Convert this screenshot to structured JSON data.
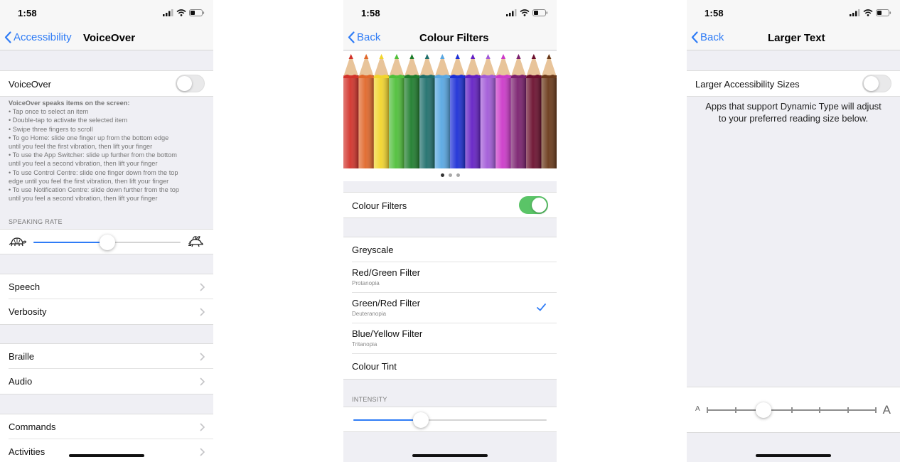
{
  "status": {
    "time": "1:58"
  },
  "phone1": {
    "back_label": "Accessibility",
    "title": "VoiceOver",
    "toggle_label": "VoiceOver",
    "toggle_on": false,
    "description_lines": [
      "VoiceOver speaks items on the screen:",
      "•  Tap once to select an item",
      "•  Double-tap to activate the selected item",
      "•  Swipe three fingers to scroll",
      "•  To go Home: slide one finger up from the bottom edge",
      "until you feel the first vibration, then lift your finger",
      "•  To use the App Switcher: slide up further from the bottom",
      "until you feel a second vibration, then lift your finger",
      "•  To use Control Centre: slide one finger down from the top",
      "edge until you feel the first vibration, then lift your finger",
      "•  To use Notification Centre: slide down further from the top",
      "until you feel a second vibration, then lift your finger"
    ],
    "speaking_rate_header": "SPEAKING RATE",
    "speaking_rate_value": 0.5,
    "groups": [
      [
        "Speech",
        "Verbosity"
      ],
      [
        "Braille",
        "Audio"
      ],
      [
        "Commands",
        "Activities"
      ]
    ]
  },
  "phone2": {
    "back_label": "Back",
    "title": "Colour Filters",
    "pencil_colors": [
      "#d2322a",
      "#e0672a",
      "#f2d52c",
      "#4fbf3a",
      "#1e7d2d",
      "#1f6f6c",
      "#58a7e2",
      "#1c2fd6",
      "#6420c4",
      "#a25ad8",
      "#cc3ac9",
      "#7a1f6e",
      "#6b0f2e",
      "#6b3a1a"
    ],
    "page_dots": 3,
    "active_dot": 0,
    "toggle_label": "Colour Filters",
    "toggle_on": true,
    "filters": [
      {
        "label": "Greyscale",
        "sub": "",
        "checked": false
      },
      {
        "label": "Red/Green Filter",
        "sub": "Protanopia",
        "checked": false
      },
      {
        "label": "Green/Red Filter",
        "sub": "Deuteranopia",
        "checked": true
      },
      {
        "label": "Blue/Yellow Filter",
        "sub": "Tritanopia",
        "checked": false
      },
      {
        "label": "Colour Tint",
        "sub": "",
        "checked": false
      }
    ],
    "intensity_header": "INTENSITY",
    "intensity_value": 0.35
  },
  "phone3": {
    "back_label": "Back",
    "title": "Larger Text",
    "toggle_label": "Larger Accessibility Sizes",
    "toggle_on": false,
    "description": "Apps that support Dynamic Type will adjust to your preferred reading size below.",
    "small_a": "A",
    "large_a": "A",
    "text_size_step": 2,
    "text_size_steps": 7
  },
  "colors": {
    "accent": "#2f7cf6",
    "toggle_on": "#5ac467",
    "background": "#efeff4"
  }
}
